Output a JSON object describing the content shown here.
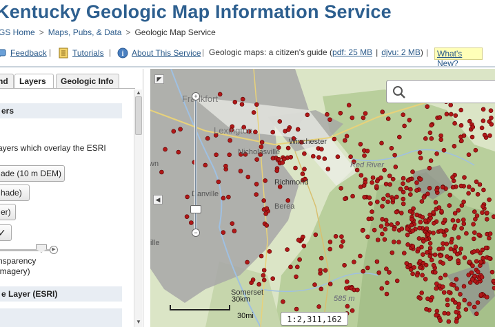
{
  "header": {
    "title": "Kentucky Geologic Map Information Service",
    "breadcrumbs": [
      "GS Home",
      "Maps, Pubs, & Data",
      "Geologic Map Service"
    ],
    "breadcrumb_sep": ">"
  },
  "links": {
    "feedback": "Feedback",
    "tutorials": "Tutorials",
    "about": "About This Service",
    "guide_text": "Geologic maps: a citizen's guide (",
    "pdf": "pdf: 25 MB",
    "djvu": "djvu: 2 MB",
    "guide_close": ")",
    "whats_new": "What's New?",
    "divider": "|"
  },
  "panel": {
    "tabs": [
      "nd",
      "Layers",
      "Geologic Info"
    ],
    "section1": "ers",
    "overlay_text": "ayers which overlay the ESRI",
    "btn_shade": "ade (10 m DEM)",
    "btn_hillshade": "hade)",
    "btn_er": "er)",
    "check_mark": "✓",
    "transparency": "nsparency",
    "imagery": "imagery)",
    "section2": "e Layer (ESRI)"
  },
  "map": {
    "scale_km": "30km",
    "scale_mi": "30mi",
    "scale_ratio": "1:2,311,162",
    "places": [
      "Frankfort",
      "Lexington",
      "Winchester",
      "Nicholasville",
      "Richmond",
      "Berea",
      "Danville",
      "Somerset",
      "Red River",
      "585 m",
      "wn",
      "ille"
    ],
    "colors": {
      "marker": "#b01818",
      "gray_region": "#9c9c9c",
      "forest": "#a6c08a",
      "water": "#a8c8e8"
    }
  }
}
